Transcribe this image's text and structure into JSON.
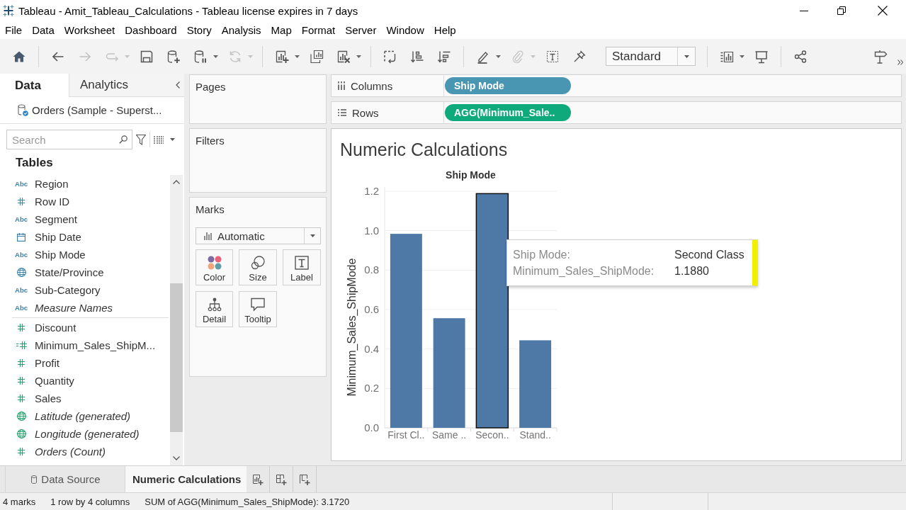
{
  "window": {
    "title": "Tableau - Amit_Tableau_Calculations - Tableau license expires in 7 days"
  },
  "menu": [
    "File",
    "Data",
    "Worksheet",
    "Dashboard",
    "Story",
    "Analysis",
    "Map",
    "Format",
    "Server",
    "Window",
    "Help"
  ],
  "toolbar": {
    "groups": [
      {
        "tools": [
          {
            "kind": "home",
            "disabled": false,
            "dropdown": false
          }
        ]
      },
      {
        "tools": [
          {
            "kind": "back",
            "disabled": false,
            "dropdown": false
          },
          {
            "kind": "forward",
            "disabled": true,
            "dropdown": false
          },
          {
            "kind": "redo",
            "disabled": true,
            "dropdown": true
          },
          {
            "kind": "save",
            "disabled": false,
            "dropdown": false
          },
          {
            "kind": "new_data_source",
            "disabled": false,
            "dropdown": false
          },
          {
            "kind": "pause_updates",
            "disabled": false,
            "dropdown": true
          },
          {
            "kind": "refresh",
            "disabled": true,
            "dropdown": true
          }
        ]
      },
      {
        "tools": [
          {
            "kind": "new_worksheet",
            "disabled": false,
            "dropdown": true
          },
          {
            "kind": "duplicate",
            "disabled": false,
            "dropdown": false
          },
          {
            "kind": "clear",
            "disabled": false,
            "dropdown": true
          }
        ]
      },
      {
        "tools": [
          {
            "kind": "swap",
            "disabled": false,
            "dropdown": false
          },
          {
            "kind": "sort_ascending",
            "disabled": false,
            "dropdown": false
          },
          {
            "kind": "sort_descending",
            "disabled": false,
            "dropdown": false
          }
        ]
      },
      {
        "tools": [
          {
            "kind": "highlight",
            "disabled": false,
            "dropdown": true
          },
          {
            "kind": "group",
            "disabled": true,
            "dropdown": true
          },
          {
            "kind": "show_labels",
            "disabled": false,
            "dropdown": false
          },
          {
            "kind": "fix_axes",
            "disabled": false,
            "dropdown": false
          },
          {
            "kind": "fit",
            "value": "Standard"
          }
        ]
      },
      {
        "tools": [
          {
            "kind": "show_cards",
            "disabled": false,
            "dropdown": true
          },
          {
            "kind": "presentation",
            "disabled": false,
            "dropdown": false
          }
        ]
      },
      {
        "tools": [
          {
            "kind": "share",
            "disabled": false,
            "dropdown": false
          }
        ]
      }
    ],
    "end_tools": [
      {
        "kind": "show_me",
        "disabled": false,
        "dropdown": false
      },
      {
        "kind": "more",
        "disabled": false,
        "dropdown": false
      }
    ]
  },
  "data_pane": {
    "tabs": [
      {
        "label": "Data",
        "selected": true
      },
      {
        "label": "Analytics",
        "selected": false
      }
    ],
    "data_source": "Orders (Sample - Superst...",
    "search": {
      "placeholder": "Search"
    },
    "section_title": "Tables",
    "fields": [
      {
        "name": "Region",
        "kind": "string",
        "type_mark": "Abc",
        "color": "#3f83a8",
        "generated": false
      },
      {
        "name": "Row ID",
        "kind": "number",
        "color": "#3f83a8",
        "generated": false
      },
      {
        "name": "Segment",
        "kind": "string",
        "type_mark": "Abc",
        "color": "#3f83a8",
        "generated": false
      },
      {
        "name": "Ship Date",
        "kind": "date",
        "color": "#3f83a8",
        "generated": false
      },
      {
        "name": "Ship Mode",
        "kind": "string",
        "type_mark": "Abc",
        "color": "#3f83a8",
        "generated": false
      },
      {
        "name": "State/Province",
        "kind": "geo",
        "color": "#3f83a8",
        "generated": false
      },
      {
        "name": "Sub-Category",
        "kind": "string",
        "type_mark": "Abc",
        "color": "#3f83a8",
        "generated": false
      },
      {
        "name": "Measure Names",
        "kind": "string",
        "type_mark": "Abc",
        "color": "#3f83a8",
        "generated": true
      },
      {
        "name": "Discount",
        "kind": "number",
        "color": "#24a06c",
        "generated": false
      },
      {
        "name": "Minimum_Sales_ShipM...",
        "kind": "calculated",
        "color": "#24a06c",
        "generated": false
      },
      {
        "name": "Profit",
        "kind": "number",
        "color": "#24a06c",
        "generated": false
      },
      {
        "name": "Quantity",
        "kind": "number",
        "color": "#24a06c",
        "generated": false
      },
      {
        "name": "Sales",
        "kind": "number",
        "color": "#24a06c",
        "generated": false
      },
      {
        "name": "Latitude (generated)",
        "kind": "geo",
        "color": "#24a06c",
        "generated": true
      },
      {
        "name": "Longitude (generated)",
        "kind": "geo",
        "color": "#24a06c",
        "generated": true
      },
      {
        "name": "Orders (Count)",
        "kind": "number",
        "color": "#24a06c",
        "generated": true
      }
    ]
  },
  "cards": [
    {
      "title": "Pages"
    },
    {
      "title": "Filters"
    }
  ],
  "marks": {
    "title": "Marks",
    "mark_type": "Automatic",
    "properties": [
      {
        "label": "Color",
        "kind": "color"
      },
      {
        "label": "Size",
        "kind": "size"
      },
      {
        "label": "Label",
        "kind": "label"
      },
      {
        "label": "Detail",
        "kind": "detail"
      },
      {
        "label": "Tooltip",
        "kind": "tooltip"
      }
    ]
  },
  "shelves": [
    {
      "label": "Columns",
      "kind": "columns",
      "pills": [
        {
          "text": "Ship Mode",
          "color": "#4996b2"
        }
      ]
    },
    {
      "label": "Rows",
      "kind": "rows",
      "pills": [
        {
          "text": "AGG(Minimum_Sale..",
          "color": "#0eaa7c"
        }
      ]
    }
  ],
  "view": {
    "title": "Numeric Calculations",
    "chart_data": {
      "type": "bar",
      "xlabel": "Ship Mode",
      "ylabel": "Minimum_Sales_ShipMode",
      "categories": [
        "First Cl..",
        "Same ..",
        "Secon..",
        "Stand.."
      ],
      "series": [
        {
          "color": "#4e79a7",
          "values": [
            0.984,
            0.556,
            1.188,
            0.444
          ]
        }
      ],
      "ylim": [
        0,
        1.2
      ],
      "yticks": [
        {
          "value": 0,
          "label": "0.0"
        },
        {
          "value": 0.2,
          "label": "0.2"
        },
        {
          "value": 0.4,
          "label": "0.4"
        },
        {
          "value": 0.6,
          "label": "0.6"
        },
        {
          "value": 0.8,
          "label": "0.8"
        },
        {
          "value": 1.0,
          "label": "1.0"
        },
        {
          "value": 1.2,
          "label": "1.2"
        }
      ],
      "grid": true
    },
    "bar_selection": [
      {
        "selected": false
      },
      {
        "selected": false
      },
      {
        "selected": true
      },
      {
        "selected": false
      }
    ],
    "tooltip": {
      "rows": [
        {
          "label": "Ship Mode:",
          "value": "Second Class"
        },
        {
          "label": "Minimum_Sales_ShipMode:",
          "value": "1.1880"
        }
      ]
    }
  },
  "sheet_tabs": [
    {
      "label": "Data Source",
      "kind": "data_source",
      "selected": false
    },
    {
      "label": "Numeric Calculations",
      "kind": "worksheet",
      "selected": true
    }
  ],
  "new_sheet_buttons": [
    {
      "kind": "worksheet"
    },
    {
      "kind": "dashboard"
    },
    {
      "kind": "story"
    }
  ],
  "status_bar": {
    "items": [
      "4 marks",
      "1 row by 4 columns",
      "SUM of AGG(Minimum_Sales_ShipMode): 3.1720"
    ]
  }
}
